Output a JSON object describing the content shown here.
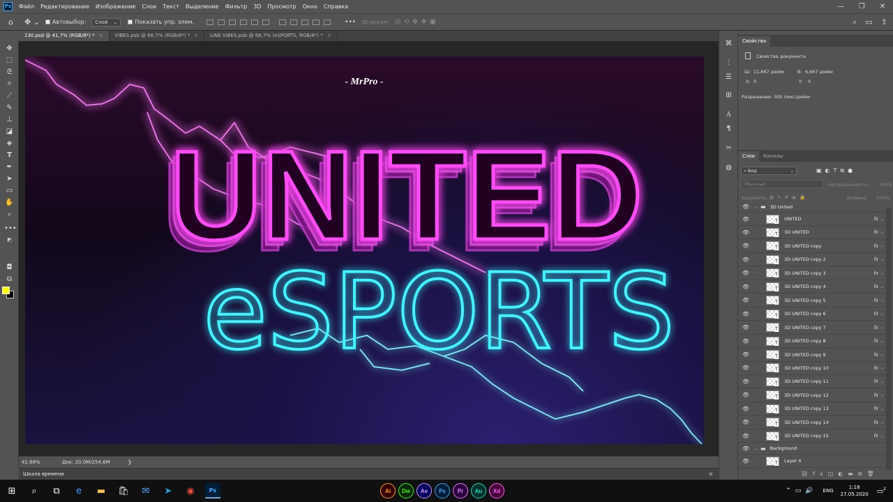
{
  "app": {
    "logo": "Ps"
  },
  "menu": [
    "Файл",
    "Редактирование",
    "Изображение",
    "Слои",
    "Текст",
    "Выделение",
    "Фильтр",
    "3D",
    "Просмотр",
    "Окно",
    "Справка"
  ],
  "window_controls": {
    "minimize": "—",
    "restore": "❐",
    "close": "✕"
  },
  "options": {
    "autoselect_label": "Автовыбор:",
    "autoselect_value": "Слой",
    "show_transform_label": "Показать упр. элем.",
    "mode_3d_label": "3D-режим:",
    "more_label": "•••"
  },
  "tabs": [
    {
      "label": "130.psd @ 41,7% (RGB/8*) *",
      "active": true,
      "close": "×"
    },
    {
      "label": "VIBES.psb @ 66,7% (RGB/8*) *",
      "active": false,
      "close": "×"
    },
    {
      "label": "LINE VIBES.psb @ 66,7% (eSPORTS, RGB/8*) *",
      "active": false,
      "close": "×"
    }
  ],
  "artwork": {
    "watermark": "- MrPro -",
    "title_line1": "UNITED",
    "title_line2": "eSPORTS",
    "colors": {
      "magenta": "#ff3cf5",
      "cyan": "#3ef6ff",
      "bg_dark": "#12081a",
      "bg_blue": "#2b1f70"
    }
  },
  "status": {
    "zoom": "41,68%",
    "doc": "Док: 20,0M/254,6M",
    "arrow": "❯"
  },
  "timeline": {
    "label": "Шкала времени",
    "menu": "≡"
  },
  "properties": {
    "tab": "Свойства",
    "doc_label": "Свойства документа",
    "w_label": "Ш:",
    "w_value": "11,667 дюйм",
    "h_label": "В:",
    "h_value": "6,667 дюйм",
    "x_label": "X:",
    "x_value": "0",
    "y_label": "Y:",
    "y_value": "0",
    "resolution": "Разрешение: 300 пикс/дюйм"
  },
  "layers_panel": {
    "tabs": [
      "Слои",
      "Каналы"
    ],
    "filter": "Вид",
    "blend_mode": "Обычные",
    "opacity_label": "Непрозрачность:",
    "opacity_value": "100%",
    "lock_label": "Закрепить:",
    "fill_label": "Заливка:",
    "fill_value": "100%",
    "groups": [
      {
        "name": "3D United"
      },
      {
        "name": "Background"
      }
    ],
    "layers": [
      {
        "name": "UNITED",
        "fx": "fx"
      },
      {
        "name": "3D UNITED",
        "fx": "fx"
      },
      {
        "name": "3D UNITED copy",
        "fx": "fx"
      },
      {
        "name": "3D UNITED copy 2",
        "fx": "fx"
      },
      {
        "name": "3D UNITED copy 3",
        "fx": "fx"
      },
      {
        "name": "3D UNITED copy 4",
        "fx": "fx"
      },
      {
        "name": "3D UNITED copy 5",
        "fx": "fx"
      },
      {
        "name": "3D UNITED copy 6",
        "fx": "fx"
      },
      {
        "name": "3D UNITED copy 7",
        "fx": "fx"
      },
      {
        "name": "3D UNITED copy 8",
        "fx": "fx"
      },
      {
        "name": "3D UNITED copy 9",
        "fx": "fx"
      },
      {
        "name": "3D UNITED copy 10",
        "fx": "fx"
      },
      {
        "name": "3D UNITED copy 11",
        "fx": "fx"
      },
      {
        "name": "3D UNITED copy 12",
        "fx": "fx"
      },
      {
        "name": "3D UNITED copy 13",
        "fx": "fx"
      },
      {
        "name": "3D UNITED copy 14",
        "fx": "fx"
      },
      {
        "name": "3D UNITED copy 15",
        "fx": "fx"
      }
    ],
    "bg_layer": {
      "name": "Layer 4"
    }
  },
  "taskbar": {
    "apps": [
      {
        "label": "Ai",
        "color": "#ff9a00",
        "bg": "#330000"
      },
      {
        "label": "Dw",
        "color": "#35fa00",
        "bg": "#072401"
      },
      {
        "label": "Ae",
        "color": "#d291ff",
        "bg": "#00005b"
      },
      {
        "label": "Ps",
        "color": "#31a8ff",
        "bg": "#001e36"
      },
      {
        "label": "Pr",
        "color": "#ea77ff",
        "bg": "#2a003d"
      },
      {
        "label": "Au",
        "color": "#00e4bb",
        "bg": "#00302a"
      },
      {
        "label": "Xd",
        "color": "#ff61f6",
        "bg": "#470137"
      }
    ],
    "lang": "ENG",
    "time": "1:18",
    "date": "27.05.2020",
    "notif": "2"
  }
}
